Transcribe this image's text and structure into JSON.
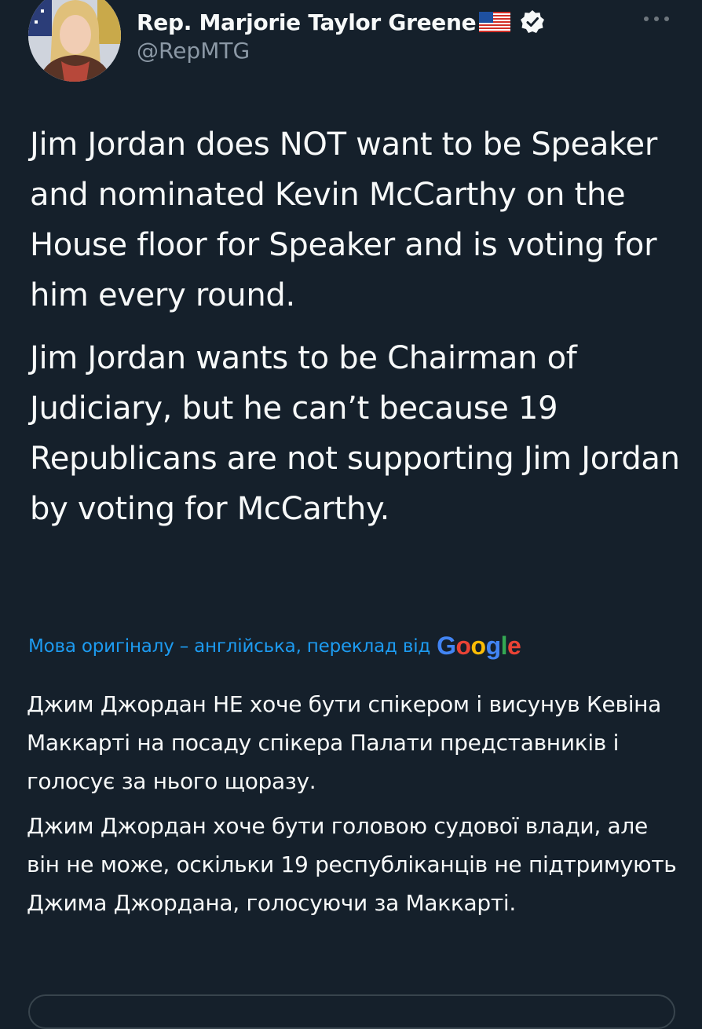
{
  "header": {
    "display_name": "Rep. Marjorie Taylor Greene",
    "handle": "@RepMTG",
    "flag_icon": "us-flag-icon",
    "verified_icon": "verified-badge-icon",
    "more_icon": "more-options-icon"
  },
  "tweet": {
    "paragraphs": [
      "Jim Jordan does NOT want to be Speaker and nominated Kevin McCarthy on the House floor for Speaker and is voting for him every round.",
      "Jim Jordan wants to be Chairman of Judiciary, but he can’t because 19 Republicans are not supporting Jim Jordan by voting for McCarthy."
    ]
  },
  "translation": {
    "label": "Мова оригіналу – англійська, переклад від",
    "provider_letters": [
      "G",
      "o",
      "o",
      "g",
      "l",
      "e"
    ],
    "paragraphs": [
      "Джим Джордан НЕ хоче бути спікером і висунув Кевіна Маккарті на посаду спікера Палати представників і голосує за нього щоразу.",
      "Джим Джордан хоче бути головою судової влади, але він не може, оскільки 19 республіканців не підтримують Джима Джордана, голосуючи за Маккарті."
    ]
  },
  "colors": {
    "background": "#15202b",
    "text": "#f7f9f9",
    "secondary_text": "#8b98a5",
    "link": "#1d9bf0"
  }
}
